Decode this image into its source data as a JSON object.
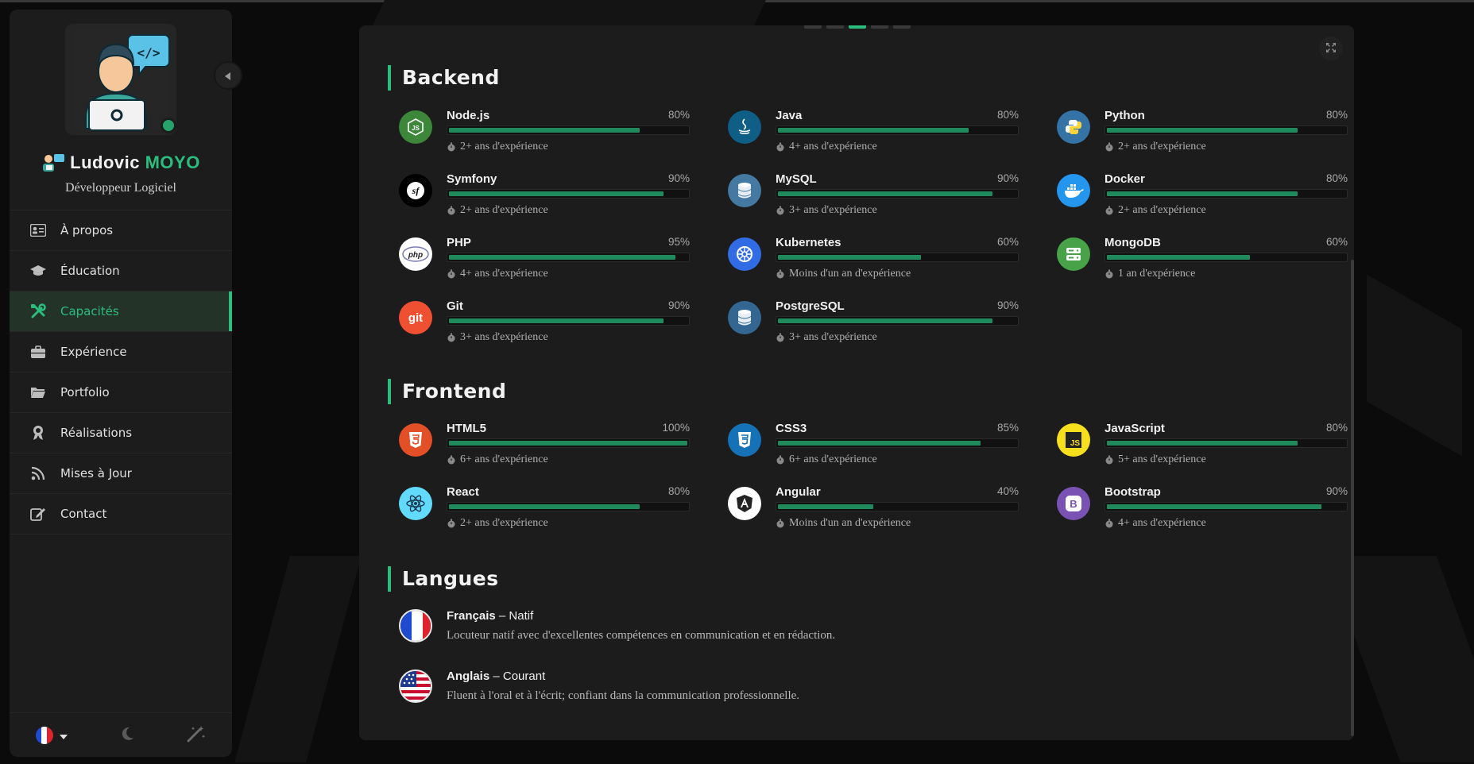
{
  "profile": {
    "first_name": "Ludovic",
    "last_name": "MOYO",
    "role": "Développeur Logiciel"
  },
  "nav": [
    {
      "label": "À propos",
      "icon": "id-card-icon",
      "active": false
    },
    {
      "label": "Éducation",
      "icon": "graduation-cap-icon",
      "active": false
    },
    {
      "label": "Capacités",
      "icon": "tools-icon",
      "active": true
    },
    {
      "label": "Expérience",
      "icon": "briefcase-icon",
      "active": false
    },
    {
      "label": "Portfolio",
      "icon": "folder-icon",
      "active": false
    },
    {
      "label": "Réalisations",
      "icon": "award-icon",
      "active": false
    },
    {
      "label": "Mises à Jour",
      "icon": "rss-icon",
      "active": false
    },
    {
      "label": "Contact",
      "icon": "edit-icon",
      "active": false
    }
  ],
  "footer": {
    "language_icon": "french-flag-icon",
    "theme_icon": "moon-icon",
    "effects_icon": "magic-wand-icon"
  },
  "sections": {
    "backend_title": "Backend",
    "frontend_title": "Frontend",
    "languages_title": "Langues"
  },
  "backend": [
    {
      "name": "Node.js",
      "percent": "80%",
      "level": 80,
      "exp": "2+ ans d'expérience",
      "logo": "nodejs-icon",
      "color": "#3c873a"
    },
    {
      "name": "Java",
      "percent": "80%",
      "level": 80,
      "exp": "4+ ans d'expérience",
      "logo": "java-icon",
      "color": "#0f5e86"
    },
    {
      "name": "Python",
      "percent": "80%",
      "level": 80,
      "exp": "2+ ans d'expérience",
      "logo": "python-icon",
      "color": "#3572a5"
    },
    {
      "name": "Symfony",
      "percent": "90%",
      "level": 90,
      "exp": "2+ ans d'expérience",
      "logo": "symfony-icon",
      "color": "#000000"
    },
    {
      "name": "MySQL",
      "percent": "90%",
      "level": 90,
      "exp": "3+ ans d'expérience",
      "logo": "mysql-icon",
      "color": "#4479a1"
    },
    {
      "name": "Docker",
      "percent": "80%",
      "level": 80,
      "exp": "2+ ans d'expérience",
      "logo": "docker-icon",
      "color": "#2496ed"
    },
    {
      "name": "PHP",
      "percent": "95%",
      "level": 95,
      "exp": "4+ ans d'expérience",
      "logo": "php-icon",
      "color": "#ffffff"
    },
    {
      "name": "Kubernetes",
      "percent": "60%",
      "level": 60,
      "exp": "Moins d'un an d'expérience",
      "logo": "kubernetes-icon",
      "color": "#326ce5"
    },
    {
      "name": "MongoDB",
      "percent": "60%",
      "level": 60,
      "exp": "1 an d'expérience",
      "logo": "mongodb-icon",
      "color": "#47a248"
    },
    {
      "name": "Git",
      "percent": "90%",
      "level": 90,
      "exp": "3+ ans d'expérience",
      "logo": "git-icon",
      "color": "#f05032"
    },
    {
      "name": "PostgreSQL",
      "percent": "90%",
      "level": 90,
      "exp": "3+ ans d'expérience",
      "logo": "postgresql-icon",
      "color": "#336791"
    }
  ],
  "frontend": [
    {
      "name": "HTML5",
      "percent": "100%",
      "level": 100,
      "exp": "6+ ans d'expérience",
      "logo": "html5-icon",
      "color": "#e34f26"
    },
    {
      "name": "CSS3",
      "percent": "85%",
      "level": 85,
      "exp": "6+ ans d'expérience",
      "logo": "css3-icon",
      "color": "#1572b6"
    },
    {
      "name": "JavaScript",
      "percent": "80%",
      "level": 80,
      "exp": "5+ ans d'expérience",
      "logo": "javascript-icon",
      "color": "#f7df1e"
    },
    {
      "name": "React",
      "percent": "80%",
      "level": 80,
      "exp": "2+ ans d'expérience",
      "logo": "react-icon",
      "color": "#61dafb"
    },
    {
      "name": "Angular",
      "percent": "40%",
      "level": 40,
      "exp": "Moins d'un an d'expérience",
      "logo": "angular-icon",
      "color": "#ffffff"
    },
    {
      "name": "Bootstrap",
      "percent": "90%",
      "level": 90,
      "exp": "4+ ans d'expérience",
      "logo": "bootstrap-icon",
      "color": "#7952b3"
    }
  ],
  "languages": [
    {
      "name": "Français",
      "level": "Natif",
      "desc": "Locuteur natif avec d'excellentes compétences en communication et en rédaction.",
      "flag": "french-flag-icon"
    },
    {
      "name": "Anglais",
      "level": "Courant",
      "desc": "Fluent à l'oral et à l'écrit; confiant dans la communication professionnelle.",
      "flag": "us-flag-icon"
    }
  ],
  "colors": {
    "accent": "#2bbd7e",
    "bar": "#1f8a5b",
    "panel": "#1c1c1c",
    "background": "#0b0b0b"
  }
}
